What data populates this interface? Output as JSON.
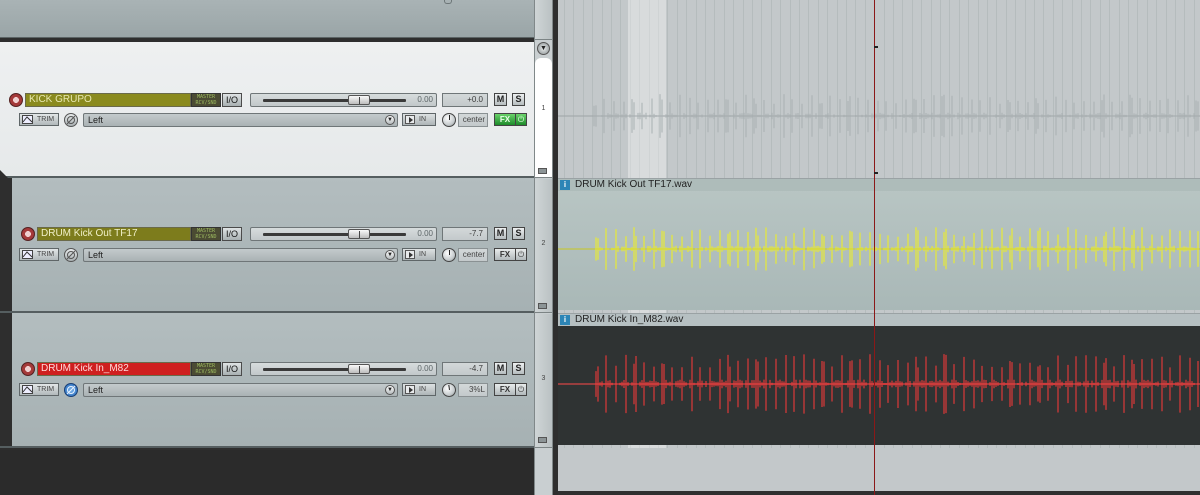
{
  "tracks": [
    {
      "number": "1",
      "name": "KICK GRUPO",
      "meter_text": "MASTER RCV/SND",
      "io_label": "I/O",
      "fader_value": "0.00",
      "volume": "+0.0",
      "mute_label": "M",
      "solo_label": "S",
      "trim_label": "TRIM",
      "input_select": "Left",
      "in_label": "IN",
      "pan": "center",
      "fx_label": "FX",
      "fx_power": "⏻"
    },
    {
      "number": "2",
      "name": "DRUM Kick Out  TF17",
      "meter_text": "MASTER RCV/SND",
      "io_label": "I/O",
      "fader_value": "0.00",
      "volume": "-7.7",
      "mute_label": "M",
      "solo_label": "S",
      "trim_label": "TRIM",
      "input_select": "Left",
      "in_label": "IN",
      "pan": "center",
      "fx_label": "FX",
      "fx_power": "⏻"
    },
    {
      "number": "3",
      "name": "DRUM Kick In_M82",
      "meter_text": "MASTER RCV/SND",
      "io_label": "I/O",
      "fader_value": "0.00",
      "volume": "-4.7",
      "mute_label": "M",
      "solo_label": "S",
      "trim_label": "TRIM",
      "input_select": "Left",
      "in_label": "IN",
      "pan": "3%L",
      "fx_label": "FX",
      "fx_power": "⏻"
    }
  ],
  "items": [
    {
      "icon": "i",
      "name": "DRUM Kick Out  TF17.wav"
    },
    {
      "icon": "i",
      "name": "DRUM Kick In_M82.wav"
    }
  ],
  "scroll": {
    "down_arrow": "▼"
  },
  "colors": {
    "track1_name_bg": "#8a8a1e",
    "track2_name_bg": "#7d7c1c",
    "track3_name_bg": "#cf1f1f",
    "wave_yellow": "#f2f21a",
    "wave_red": "#ff3030",
    "playhead": "#8b1818",
    "fx_active": "#1d8a2a"
  }
}
